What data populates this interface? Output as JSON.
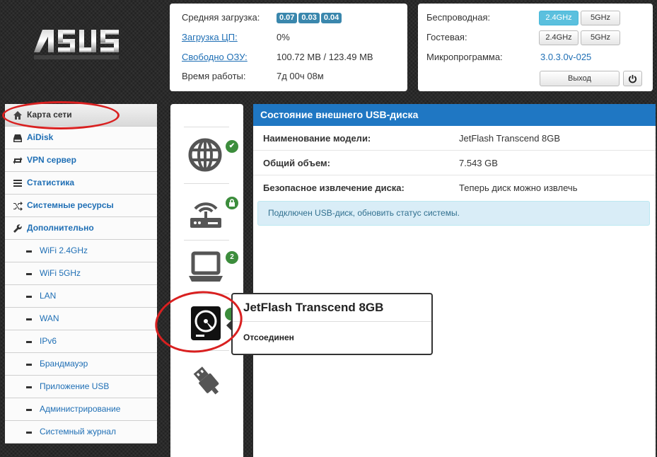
{
  "logo": {
    "text": "ASUS"
  },
  "system": {
    "load_label": "Средняя загрузка:",
    "load_values": [
      "0.07",
      "0.03",
      "0.04"
    ],
    "cpu_label": "Загрузка ЦП:",
    "cpu_value": "0%",
    "ram_label": "Свободно ОЗУ:",
    "ram_value": "100.72 MB / 123.49 MB",
    "uptime_label": "Время работы:",
    "uptime_value": "7д 00ч 08м"
  },
  "wireless": {
    "wireless_label": "Беспроводная:",
    "guest_label": "Гостевая:",
    "band_24": "2.4GHz",
    "band_5": "5GHz",
    "firmware_label": "Микропрограмма:",
    "firmware_value": "3.0.3.0v-025",
    "logout_label": "Выход"
  },
  "menu": {
    "items": [
      {
        "label": "Карта сети",
        "icon": "home-icon",
        "active": true
      },
      {
        "label": "AiDisk",
        "icon": "disk-icon"
      },
      {
        "label": "VPN сервер",
        "icon": "vpn-arrows-icon"
      },
      {
        "label": "Статистика",
        "icon": "list-icon"
      },
      {
        "label": "Системные ресурсы",
        "icon": "shuffle-icon"
      },
      {
        "label": "Дополнительно",
        "icon": "wrench-icon"
      }
    ],
    "sub_items": [
      "WiFi 2.4GHz",
      "WiFi 5GHz",
      "LAN",
      "WAN",
      "IPv6",
      "Брандмауэр",
      "Приложение USB",
      "Администрирование",
      "Системный журнал"
    ]
  },
  "devices": {
    "clients_count": "2"
  },
  "usb": {
    "header": "Состояние внешнего USB-диска",
    "model_label": "Наименование модели:",
    "model_value": "JetFlash Transcend 8GB",
    "size_label": "Общий объем:",
    "size_value": "7.543 GB",
    "eject_label": "Безопасное извлечение диска:",
    "eject_value": "Теперь диск можно извлечь",
    "alert": "Подключен USB-диск, обновить статус системы."
  },
  "popover": {
    "title": "JetFlash Transcend 8GB",
    "status": "Отсоединен"
  },
  "colors": {
    "accent": "#1f77c3",
    "link": "#1f6fb5",
    "status_ok": "#3c8d3c",
    "annotation": "#d92020"
  }
}
